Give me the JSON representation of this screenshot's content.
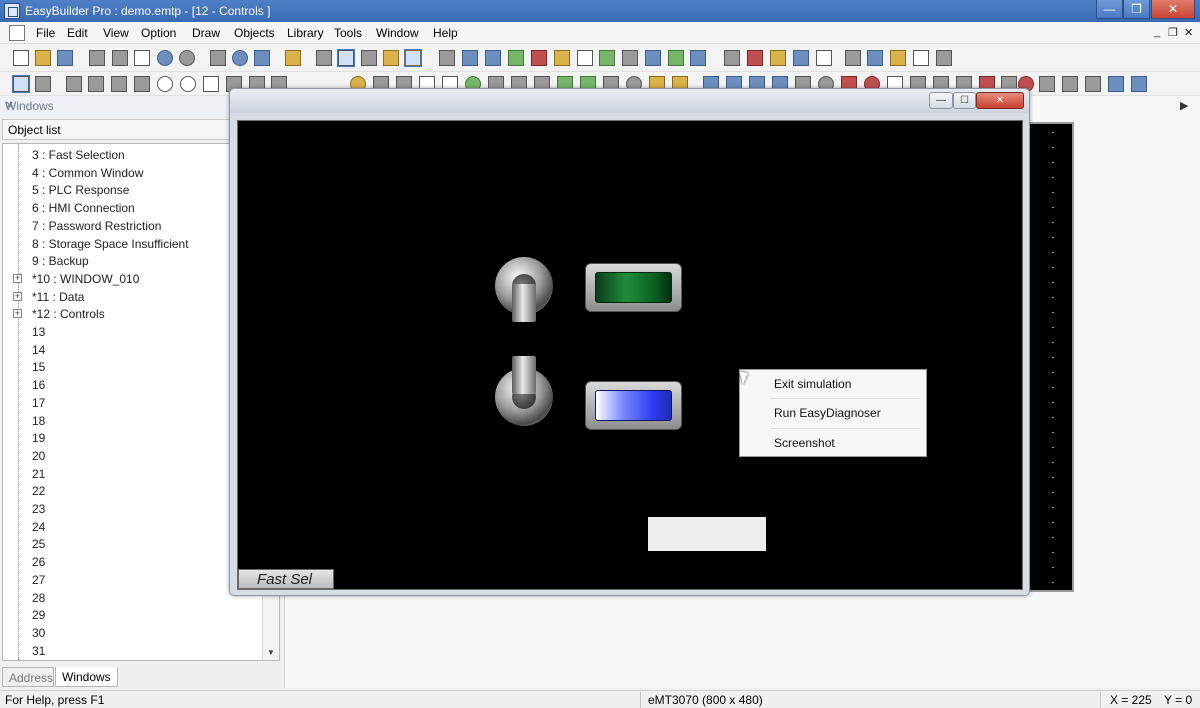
{
  "window": {
    "title": "EasyBuilder Pro : demo.emtp - [12 - Controls ]",
    "minimize_glyph": "—",
    "restore_glyph": "❐",
    "close_glyph": "✕"
  },
  "menu": {
    "items": [
      "File",
      "Edit",
      "View",
      "Option",
      "Draw",
      "Objects",
      "Library",
      "Tools",
      "Window",
      "Help"
    ],
    "mdi_minimize": "_",
    "mdi_restore": "❐",
    "mdi_close": "✕"
  },
  "left_panel": {
    "header": "Windows",
    "pin_glyph": "✕",
    "object_list_label": "Object list",
    "tree_items": [
      {
        "label": "3 : Fast Selection",
        "expandable": false
      },
      {
        "label": "4 : Common Window",
        "expandable": false
      },
      {
        "label": "5 : PLC Response",
        "expandable": false
      },
      {
        "label": "6 : HMI Connection",
        "expandable": false
      },
      {
        "label": "7 : Password Restriction",
        "expandable": false
      },
      {
        "label": "8 : Storage Space Insufficient",
        "expandable": false
      },
      {
        "label": "9 : Backup",
        "expandable": false
      },
      {
        "label": "*10 : WINDOW_010",
        "expandable": true
      },
      {
        "label": "*11 : Data",
        "expandable": true
      },
      {
        "label": "*12 : Controls",
        "expandable": true
      },
      {
        "label": "13",
        "expandable": false
      },
      {
        "label": "14",
        "expandable": false
      },
      {
        "label": "15",
        "expandable": false
      },
      {
        "label": "16",
        "expandable": false
      },
      {
        "label": "17",
        "expandable": false
      },
      {
        "label": "18",
        "expandable": false
      },
      {
        "label": "19",
        "expandable": false
      },
      {
        "label": "20",
        "expandable": false
      },
      {
        "label": "21",
        "expandable": false
      },
      {
        "label": "22",
        "expandable": false
      },
      {
        "label": "23",
        "expandable": false
      },
      {
        "label": "24",
        "expandable": false
      },
      {
        "label": "25",
        "expandable": false
      },
      {
        "label": "26",
        "expandable": false
      },
      {
        "label": "27",
        "expandable": false
      },
      {
        "label": "28",
        "expandable": false
      },
      {
        "label": "29",
        "expandable": false
      },
      {
        "label": "30",
        "expandable": false
      },
      {
        "label": "31",
        "expandable": false
      }
    ],
    "expand_glyph": "+",
    "scroll_down_glyph": "▼",
    "tabs": {
      "address": "Address",
      "windows": "Windows"
    }
  },
  "workspace": {
    "scroll_right_glyph": "▶"
  },
  "simulation": {
    "min_glyph": "—",
    "max_glyph": "☐",
    "close_glyph": "✕",
    "lamp_green_color": "#1f8d3a",
    "lamp_blue_color": "#2d3cf3",
    "fast_sel_label": "Fast Sel"
  },
  "context_menu": {
    "items": [
      "Exit simulation",
      "Run EasyDiagnoser",
      "Screenshot"
    ]
  },
  "status": {
    "help": "For Help, press F1",
    "model": "eMT3070 (800 x 480)",
    "x": "X = 225",
    "y": "Y = 0"
  },
  "toolbar_icons": [
    "new-file-icon",
    "open-folder-icon",
    "save-icon",
    "cut-icon",
    "copy-icon",
    "paste-icon",
    "undo-icon",
    "redo-icon",
    "print-icon",
    "help-icon",
    "select-icon",
    "line-icon",
    "circle-icon",
    "rectangle-icon"
  ]
}
